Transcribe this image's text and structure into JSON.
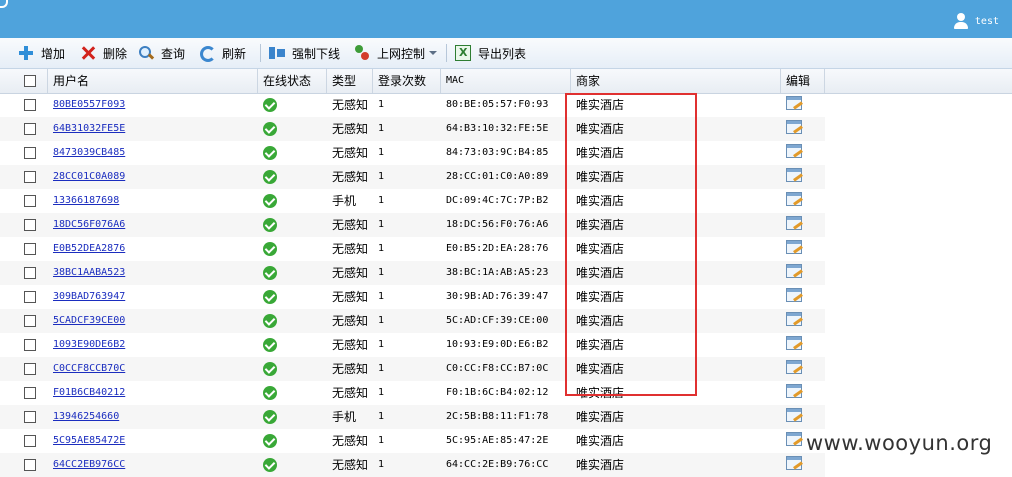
{
  "header": {
    "username": "test"
  },
  "toolbar": {
    "add": "增加",
    "delete": "删除",
    "search": "查询",
    "refresh": "刷新",
    "force_offline": "强制下线",
    "net_control": "上网控制",
    "export_list": "导出列表"
  },
  "columns": {
    "username": "用户名",
    "online_status": "在线状态",
    "type": "类型",
    "login_count": "登录次数",
    "mac": "MAC",
    "merchant": "商家",
    "edit": "编辑"
  },
  "rows": [
    {
      "username": "80BE0557F093",
      "type": "无感知",
      "logins": "1",
      "mac": "80:BE:05:57:F0:93",
      "merchant": "唯实酒店"
    },
    {
      "username": "64B31032FE5E",
      "type": "无感知",
      "logins": "1",
      "mac": "64:B3:10:32:FE:5E",
      "merchant": "唯实酒店"
    },
    {
      "username": "8473039CB485",
      "type": "无感知",
      "logins": "1",
      "mac": "84:73:03:9C:B4:85",
      "merchant": "唯实酒店"
    },
    {
      "username": "28CC01C0A089",
      "type": "无感知",
      "logins": "1",
      "mac": "28:CC:01:C0:A0:89",
      "merchant": "唯实酒店"
    },
    {
      "username": "13366187698",
      "type": "手机",
      "logins": "1",
      "mac": "DC:09:4C:7C:7P:B2",
      "merchant": "唯实酒店"
    },
    {
      "username": "18DC56F076A6",
      "type": "无感知",
      "logins": "1",
      "mac": "18:DC:56:F0:76:A6",
      "merchant": "唯实酒店"
    },
    {
      "username": "E0B52DEA2876",
      "type": "无感知",
      "logins": "1",
      "mac": "E0:B5:2D:EA:28:76",
      "merchant": "唯实酒店"
    },
    {
      "username": "38BC1AABA523",
      "type": "无感知",
      "logins": "1",
      "mac": "38:BC:1A:AB:A5:23",
      "merchant": "唯实酒店"
    },
    {
      "username": "309BAD763947",
      "type": "无感知",
      "logins": "1",
      "mac": "30:9B:AD:76:39:47",
      "merchant": "唯实酒店"
    },
    {
      "username": "5CADCF39CE00",
      "type": "无感知",
      "logins": "1",
      "mac": "5C:AD:CF:39:CE:00",
      "merchant": "唯实酒店"
    },
    {
      "username": "1093E90DE6B2",
      "type": "无感知",
      "logins": "1",
      "mac": "10:93:E9:0D:E6:B2",
      "merchant": "唯实酒店"
    },
    {
      "username": "C0CCF8CCB70C",
      "type": "无感知",
      "logins": "1",
      "mac": "C0:CC:F8:CC:B7:0C",
      "merchant": "唯实酒店"
    },
    {
      "username": "F01B6CB40212",
      "type": "无感知",
      "logins": "1",
      "mac": "F0:1B:6C:B4:02:12",
      "merchant": "唯实酒店"
    },
    {
      "username": "13946254660",
      "type": "手机",
      "logins": "1",
      "mac": "2C:5B:B8:11:F1:78",
      "merchant": "唯实酒店"
    },
    {
      "username": "5C95AE85472E",
      "type": "无感知",
      "logins": "1",
      "mac": "5C:95:AE:85:47:2E",
      "merchant": "唯实酒店"
    },
    {
      "username": "64CC2EB976CC",
      "type": "无感知",
      "logins": "1",
      "mac": "64:CC:2E:B9:76:CC",
      "merchant": "唯实酒店"
    }
  ],
  "watermark": "www.wooyun.org"
}
